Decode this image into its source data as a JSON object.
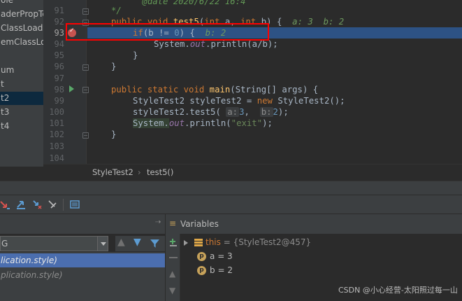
{
  "tree": {
    "items": [
      {
        "label": "ole",
        "selected": false
      },
      {
        "label": "aderPropTe",
        "selected": false
      },
      {
        "label": "ClassLoade",
        "selected": false
      },
      {
        "label": "emClassLoa",
        "selected": false
      },
      {
        "label": "um",
        "selected": false
      },
      {
        "label": "t",
        "selected": false
      },
      {
        "label": "t2",
        "selected": true
      },
      {
        "label": "t3",
        "selected": false
      },
      {
        "label": "t4",
        "selected": false
      }
    ]
  },
  "editor": {
    "line_numbers": [
      "91",
      "92",
      "93",
      "94",
      "95",
      "96",
      "97",
      "98",
      "99",
      "100",
      "101",
      "102",
      "103",
      "104"
    ],
    "lines": {
      "l91_comment": "@date 2020/6/22 16:4",
      "l91_close": "*/",
      "l92_sig": "public void test5(int a, int b) {",
      "l92_hint": "a: 3  b: 2",
      "l93_code": "if(b != 0) {",
      "l93_hint": "b: 2",
      "l94_code": "System.out.println(a/b);",
      "l95_code": "}",
      "l96_code": "}",
      "l98_code": "public static void main(String[] args) {",
      "l99_code": "StyleTest2 styleTest2 = new StyleTest2();",
      "l100_code": "styleTest2.test5(",
      "l100_a": "a:",
      "l100_a_val": "3",
      "l100_b": "b:",
      "l100_b_val": "2",
      "l100_end": ");",
      "l101_code": "System.out.println(\"exit\");",
      "l102_code": "}"
    },
    "breadcrumb": [
      "StyleTest2",
      "test5()"
    ]
  },
  "debug": {
    "thread_combo_value": "G",
    "frames": [
      {
        "label": "lication.style)",
        "selected": true
      },
      {
        "label": "plication.style)",
        "selected": false
      }
    ],
    "variables_title": "Variables",
    "variables": [
      {
        "name": "this",
        "value": "= {StyleTest2@457}",
        "kind": "object",
        "expandable": true
      },
      {
        "name": "a",
        "value": "= 3",
        "kind": "param",
        "expandable": false
      },
      {
        "name": "b",
        "value": "= 2",
        "kind": "param",
        "expandable": false
      }
    ]
  },
  "watermark": "CSDN @小心经营-太阳照过每一山",
  "colors": {
    "accent_selection": "#4b6eaf",
    "breakpoint_line": "#2d5284",
    "breakpoint_dot": "#c75450",
    "annotation_box": "#ff0000"
  }
}
